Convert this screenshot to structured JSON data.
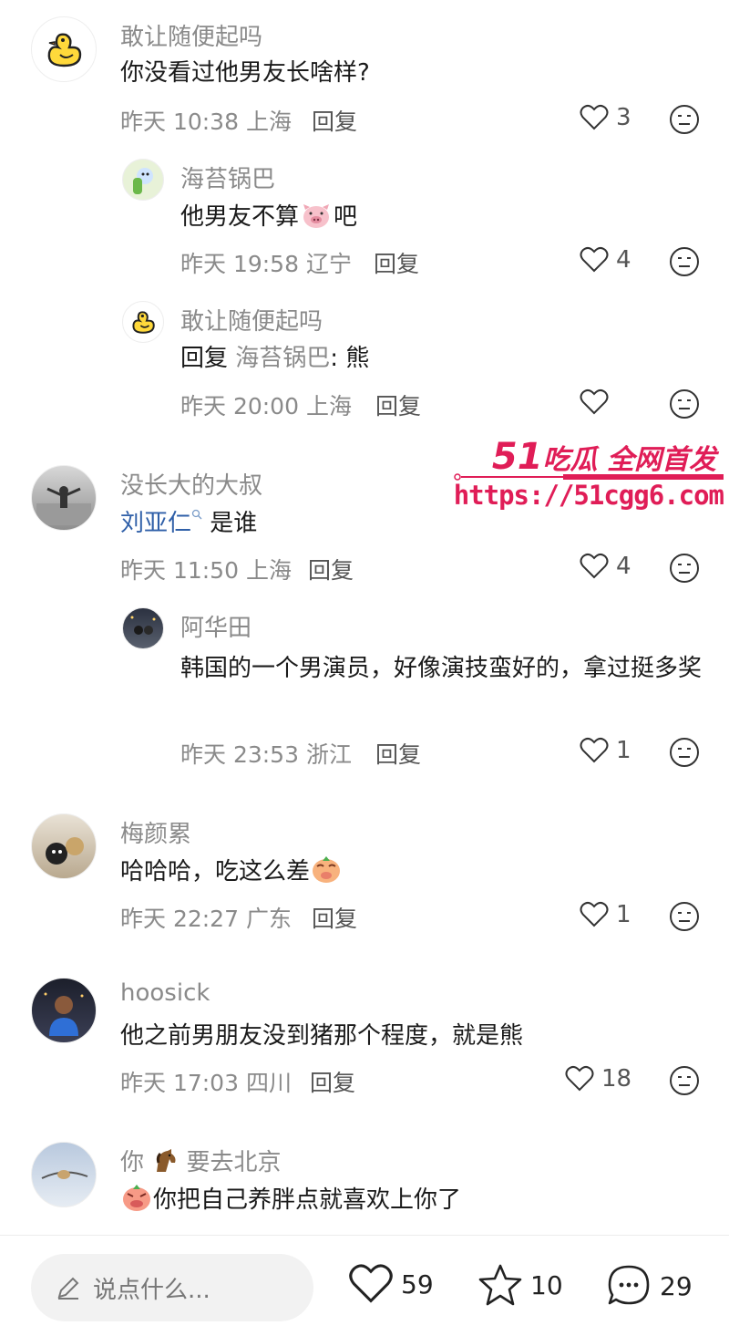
{
  "comments": [
    {
      "name": "敢让随便起吗",
      "text": "你没看过他男友长啥样?",
      "time": "昨天 10:38 上海",
      "reply": "回复",
      "likes": "3"
    },
    {
      "name": "海苔锅巴",
      "text_before": "他男友不算",
      "text_after": "吧",
      "time": "昨天 19:58 辽宁",
      "reply": "回复",
      "likes": "4"
    },
    {
      "name": "敢让随便起吗",
      "reply_prefix": "回复",
      "reply_target": "海苔锅巴",
      "text": ": 熊",
      "time": "昨天 20:00 上海",
      "reply": "回复",
      "likes": ""
    },
    {
      "name": "没长大的大叔",
      "mention": "刘亚仁",
      "text": " 是谁",
      "time": "昨天 11:50 上海",
      "reply": "回复",
      "likes": "4"
    },
    {
      "name": "阿华田",
      "text": "韩国的一个男演员，好像演技蛮好的，拿过挺多奖",
      "time": "昨天 23:53 浙江",
      "reply": "回复",
      "likes": "1"
    },
    {
      "name": "梅颜累",
      "text": "哈哈哈，吃这么差",
      "time": "昨天 22:27 广东",
      "reply": "回复",
      "likes": "1"
    },
    {
      "name": "hoosick",
      "text": "他之前男朋友没到猪那个程度，就是熊",
      "time": "昨天 17:03 四川",
      "reply": "回复",
      "likes": "18"
    },
    {
      "name_before": "你",
      "name_after": "要去北京",
      "text": "你把自己养胖点就喜欢上你了"
    }
  ],
  "watermark": {
    "brand_num": "51",
    "brand_text": "吃瓜 全网首发",
    "url": "https://51cgg6.com"
  },
  "bottom_bar": {
    "placeholder": "说点什么...",
    "likes": "59",
    "stars": "10",
    "comments": "29"
  },
  "colors": {
    "accent": "#e01d57",
    "mention": "#2f5fa8",
    "muted": "#8a8a8a"
  }
}
